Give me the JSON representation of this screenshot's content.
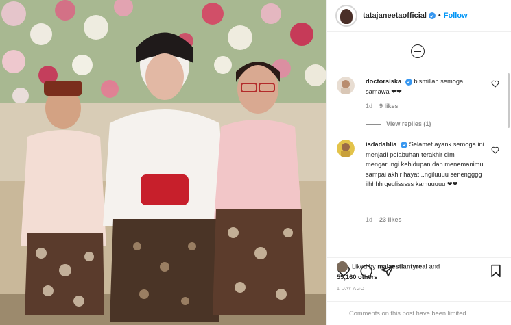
{
  "post": {
    "username": "tatajaneetaofficial",
    "separator": "•",
    "follow_label": "Follow"
  },
  "comments": [
    {
      "username": "doctorsiska",
      "text": "bismillah semoga samawa ❤❤",
      "age": "1d",
      "likes": "9 likes",
      "view_replies": "View replies (1)"
    },
    {
      "username": "isdadahlia",
      "text": "Selamet ayank semoga ini menjadi pelabuhan terakhir dlm mengarungi kehidupan dan menemanimu sampai akhir hayat ..ngiluuuu senengggg iihhhh geulisssss kamuuuuu ❤❤",
      "age": "1d",
      "likes": "23 likes"
    }
  ],
  "engagement": {
    "liked_by_prefix": "Liked by ",
    "liked_by_user": "maiaestiantyreal",
    "liked_by_and": " and",
    "others": "55,160 others",
    "time_ago": "1 DAY AGO",
    "comments_notice": "Comments on this post have been limited."
  },
  "icons": [
    "verified-badge-icon",
    "add-comment-icon",
    "heart-icon",
    "comment-icon",
    "share-icon",
    "bookmark-icon"
  ],
  "colors": {
    "link": "#0095f6",
    "verified": "#3897f0",
    "muted": "#8e8e8e",
    "text": "#262626"
  }
}
